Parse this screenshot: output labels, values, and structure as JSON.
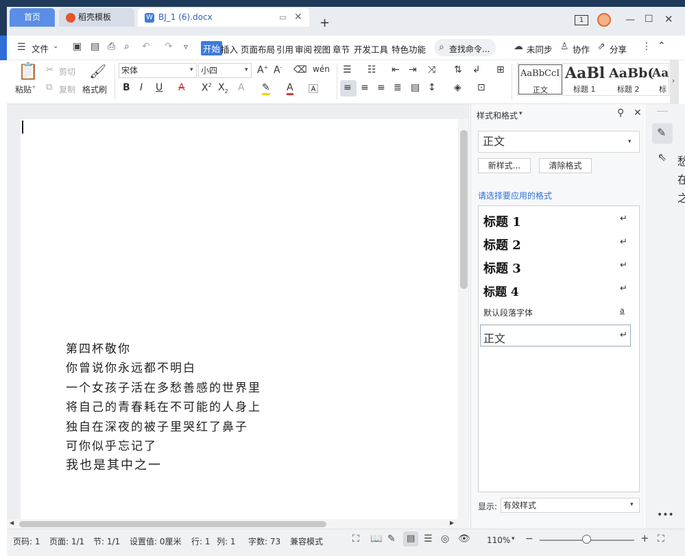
{
  "tabs": [
    {
      "label": "首页"
    },
    {
      "label": "稻壳模板"
    },
    {
      "label": "BJ_1 (6).docx"
    }
  ],
  "window": {
    "badge": "1"
  },
  "menu": {
    "file": "文件",
    "items": [
      "开始",
      "插入",
      "页面布局",
      "引用",
      "审阅",
      "视图",
      "章节",
      "开发工具",
      "特色功能"
    ],
    "search": "查找命令...",
    "sync": "未同步",
    "collab": "协作",
    "share": "分享"
  },
  "ribbon": {
    "paste": "粘贴",
    "cut": "剪切",
    "copy": "复制",
    "format_painter": "格式刷",
    "font": "宋体",
    "size": "小四",
    "styles": [
      {
        "preview": "AaBbCcI",
        "label": "正文"
      },
      {
        "preview": "AaBl",
        "label": "标题 1"
      },
      {
        "preview": "AaBb(",
        "label": "标题 2"
      },
      {
        "preview": "Aa",
        "label": "标"
      }
    ]
  },
  "document": {
    "lines": [
      "第四杯敬你",
      "你曾说你永远都不明白",
      "一个女孩子活在多愁善感的世界里",
      "将自己的青春耗在不可能的人身上",
      "独自在深夜的被子里哭红了鼻子",
      "可你似乎忘记了",
      "我也是其中之一"
    ]
  },
  "panel": {
    "title": "样式和格式",
    "current": "正文",
    "new_style": "新样式...",
    "clear": "清除格式",
    "hint": "请选择要应用的格式",
    "styles": [
      "标题 1",
      "标题 2",
      "标题 3",
      "标题 4",
      "默认段落字体",
      "正文"
    ],
    "show_label": "显示:",
    "show_value": "有效样式"
  },
  "strip_text": [
    "愁",
    "在",
    "之"
  ],
  "status": {
    "page_no": "页码: 1",
    "pages": "页面: 1/1",
    "section": "节: 1/1",
    "setting": "设置值: 0厘米",
    "row": "行: 1",
    "col": "列: 1",
    "words": "字数: 73",
    "mode": "兼容模式",
    "zoom": "110%"
  },
  "colors": {
    "accent": "#3e7bdc",
    "titlebar": "#1f3a5a"
  }
}
